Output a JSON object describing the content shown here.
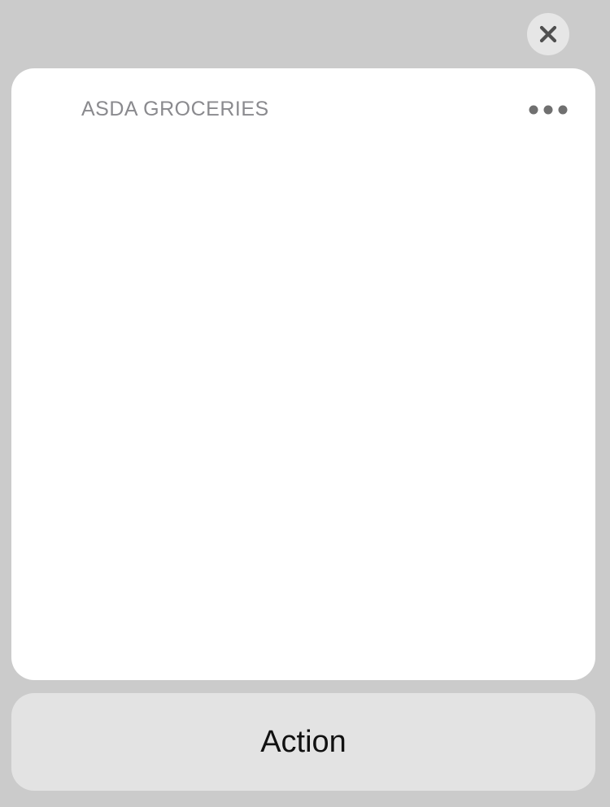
{
  "sheet": {
    "close_icon": "close-icon",
    "card": {
      "app_name": "ASDA GROCERIES",
      "more_icon": "ellipsis-icon"
    },
    "action_label": "Action"
  }
}
